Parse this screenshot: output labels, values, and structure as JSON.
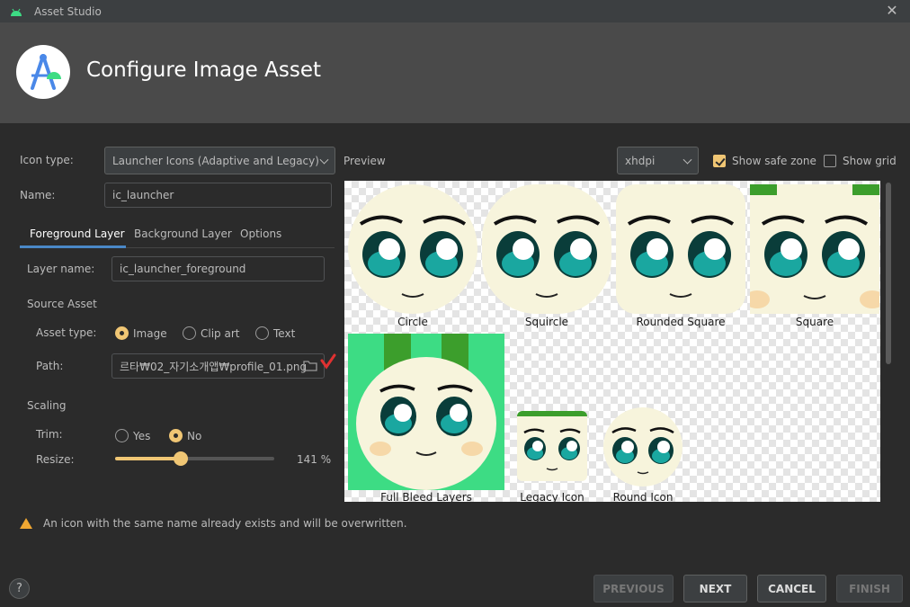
{
  "window": {
    "title": "Asset Studio"
  },
  "header": {
    "title": "Configure Image Asset"
  },
  "form": {
    "icon_type_label": "Icon type:",
    "icon_type_value": "Launcher Icons (Adaptive and Legacy)",
    "name_label": "Name:",
    "name_value": "ic_launcher",
    "tabs": [
      "Foreground Layer",
      "Background Layer",
      "Options"
    ],
    "layer_name_label": "Layer name:",
    "layer_name_value": "ic_launcher_foreground",
    "source_asset_label": "Source Asset",
    "asset_type_label": "Asset type:",
    "asset_types": [
      "Image",
      "Clip art",
      "Text"
    ],
    "asset_type_selected": "Image",
    "path_label": "Path:",
    "path_value": "르타₩02_자기소개앱₩profile_01.png",
    "scaling_label": "Scaling",
    "trim_label": "Trim:",
    "trim_options": [
      "Yes",
      "No"
    ],
    "trim_selected": "No",
    "resize_label": "Resize:",
    "resize_value": "141 %",
    "resize_fraction": 0.41
  },
  "preview": {
    "label": "Preview",
    "density": "xhdpi",
    "show_safe_zone_label": "Show safe zone",
    "show_safe_zone": true,
    "show_grid_label": "Show grid",
    "show_grid": false,
    "icons": [
      "Circle",
      "Squircle",
      "Rounded Square",
      "Square",
      "Full Bleed Layers",
      "Legacy Icon",
      "Round Icon"
    ]
  },
  "warning": {
    "text": "An icon with the same name already exists and will be overwritten."
  },
  "footer": {
    "help_label": "?",
    "previous_label": "PREVIOUS",
    "next_label": "NEXT",
    "cancel_label": "CANCEL",
    "finish_label": "FINISH"
  },
  "colors": {
    "accent": "#f0c674",
    "background": "#2b2b2b",
    "header": "#4a4a4a",
    "icon_bg": "#3ddc84",
    "warning": "#f0a732"
  }
}
